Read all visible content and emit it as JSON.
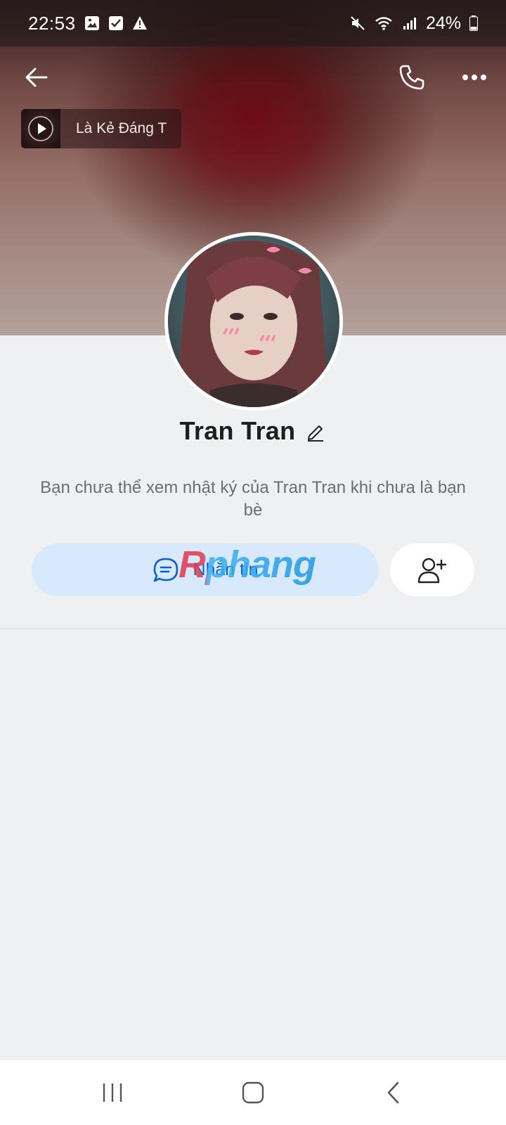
{
  "status_bar": {
    "time": "22:53",
    "battery": "24%",
    "icons": [
      "image-icon",
      "check-icon",
      "warning-icon",
      "mute-icon",
      "wifi-icon",
      "signal-icon",
      "battery-icon"
    ]
  },
  "header": {
    "back_icon": "back-arrow-icon",
    "call_icon": "phone-icon",
    "more_icon": "more-icon"
  },
  "music": {
    "title": "Là Kẻ Đáng T",
    "play_icon": "play-icon"
  },
  "profile": {
    "name": "Tran Tran",
    "edit_icon": "edit-pencil-icon",
    "info": "Bạn chưa thể xem nhật ký của Tran Tran khi chưa là bạn bè"
  },
  "actions": {
    "message_label": "Nhắn tin",
    "message_icon": "chat-bubble-icon",
    "add_friend_icon": "add-friend-icon"
  },
  "watermark": {
    "text": "Rphang"
  },
  "nav_bar": {
    "items": [
      "recent-apps-icon",
      "home-icon",
      "back-icon"
    ]
  },
  "colors": {
    "accent": "#0a5fd1",
    "message_button_bg": "#d9e9fd",
    "page_bg": "#eef0f2"
  }
}
